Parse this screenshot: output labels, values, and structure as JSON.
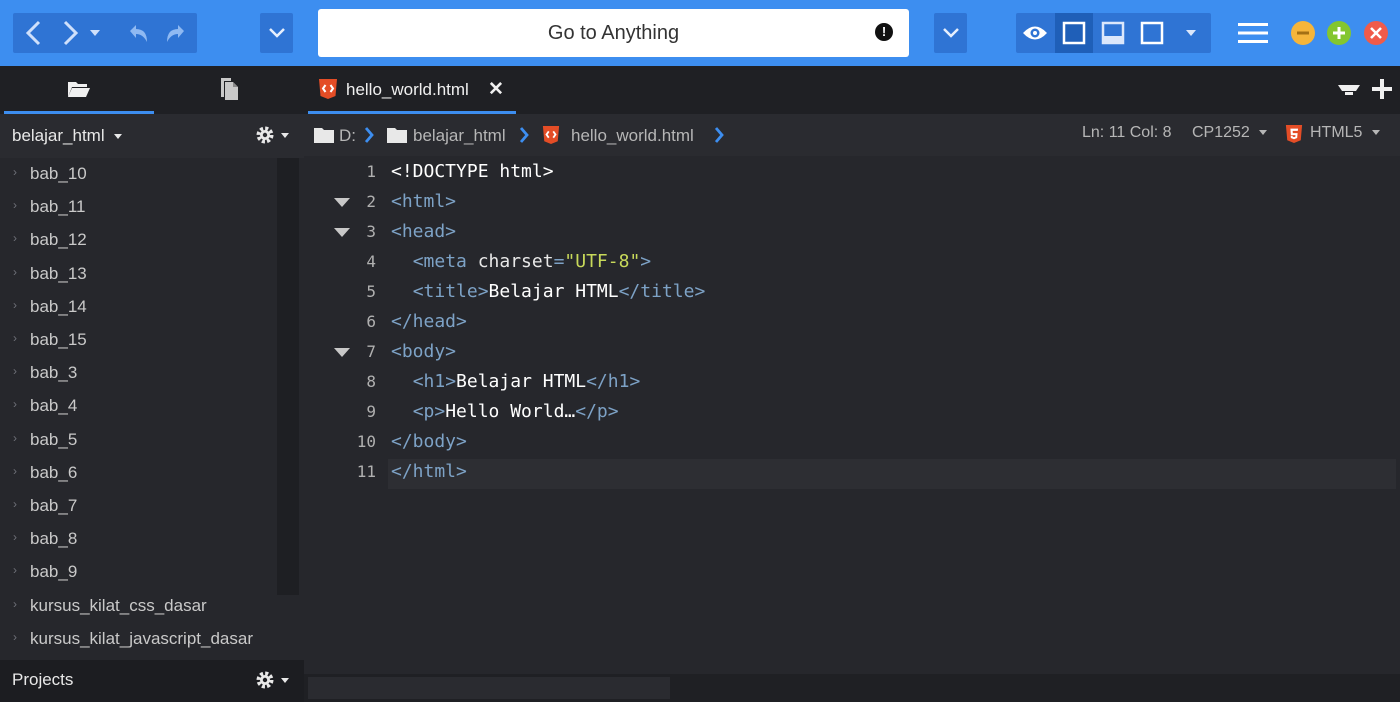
{
  "toolbar": {
    "goto_placeholder": "Go to Anything",
    "goto_alert": "!",
    "buttons": [
      "back",
      "forward",
      "history-dropdown",
      "undo",
      "redo",
      "open-menu",
      "goto-dropdown",
      "preview",
      "toggle-sidebar",
      "toggle-bottom-panel",
      "toggle-right-panel",
      "layout-dropdown",
      "main-menu"
    ],
    "window_controls": {
      "minimize_color": "#f5b53b",
      "maximize_color": "#84c62f",
      "close_color": "#f05b4a"
    }
  },
  "sidebar": {
    "tabs": [
      "places",
      "open-files"
    ],
    "project": "belajar_html",
    "tree": [
      "bab_10",
      "bab_11",
      "bab_12",
      "bab_13",
      "bab_14",
      "bab_15",
      "bab_3",
      "bab_4",
      "bab_5",
      "bab_6",
      "bab_7",
      "bab_8",
      "bab_9",
      "kursus_kilat_css_dasar",
      "kursus_kilat_javascript_dasar"
    ],
    "projects_label": "Projects"
  },
  "editor": {
    "tab": {
      "title": "hello_world.html",
      "close": "✕"
    },
    "breadcrumb": {
      "drive": "D:",
      "folder": "belajar_html",
      "file": "hello_world.html"
    },
    "status": {
      "position": "Ln: 11 Col: 8",
      "encoding": "CP1252",
      "language": "HTML5"
    },
    "lines": [
      {
        "n": "1",
        "fold": false
      },
      {
        "n": "2",
        "fold": true
      },
      {
        "n": "3",
        "fold": true
      },
      {
        "n": "4",
        "fold": false
      },
      {
        "n": "5",
        "fold": false
      },
      {
        "n": "6",
        "fold": false
      },
      {
        "n": "7",
        "fold": true
      },
      {
        "n": "8",
        "fold": false
      },
      {
        "n": "9",
        "fold": false
      },
      {
        "n": "10",
        "fold": false
      },
      {
        "n": "11",
        "fold": false
      }
    ],
    "code": {
      "l1": "<!DOCTYPE html>",
      "l2_open": "<html>",
      "l3_open": "<head>",
      "l4_tag": "<meta",
      "l4_attr": " charset",
      "l4_eq": "=",
      "l4_str": "\"UTF-8\"",
      "l4_close": ">",
      "l5_open": "<title>",
      "l5_text": "Belajar HTML",
      "l5_close": "</title>",
      "l6": "</head>",
      "l7": "<body>",
      "l8_open": "<h1>",
      "l8_text": "Belajar HTML",
      "l8_close": "</h1>",
      "l9_open": "<p>",
      "l9_text": "Hello World…",
      "l9_close": "</p>",
      "l10": "</body>",
      "l11": "</html>"
    }
  },
  "colors": {
    "accent": "#3d8ef0",
    "html_badge": "#e44d26"
  }
}
